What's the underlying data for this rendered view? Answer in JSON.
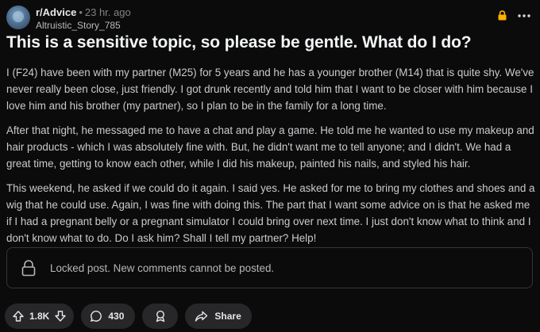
{
  "post": {
    "subreddit": "r/Advice",
    "time_ago": "23 hr. ago",
    "separator": "•",
    "author": "Altruistic_Story_785",
    "title": "This is a sensitive topic, so please be gentle. What do I do?",
    "paragraphs": [
      "I (F24) have been with my partner (M25) for 5 years and he has a younger brother (M14) that is quite shy. We've never really been close, just friendly. I got drunk recently and told him that I want to be closer with him because I love him and his brother (my partner), so I plan to be in the family for a long time.",
      "After that night, he messaged me to have a chat and play a game. He told me he wanted to use my makeup and hair products - which I was absolutely fine with. But, he didn't want me to tell anyone; and I didn't. We had a great time, getting to know each other, while I did his makeup, painted his nails, and styled his hair.",
      "This weekend, he asked if we could do it again. I said yes. He asked for me to bring my clothes and shoes and a wig that he could use. Again, I was fine with doing this. The part that I want some advice on is that he asked me if I had a pregnant belly or a pregnant simulator I could bring over next time. I just don't know what to think and I don't know what to do. Do I ask him? Shall I tell my partner? Help!"
    ],
    "locked_notice": "Locked post. New comments cannot be posted.",
    "votes": "1.8K",
    "comments": "430",
    "share_label": "Share"
  },
  "colors": {
    "background": "#0b0b0c",
    "lock_accent": "#ffb000",
    "pill_background": "#272729",
    "border": "#343536"
  },
  "icons": [
    "lock-icon",
    "more-options-icon",
    "upvote-icon",
    "downvote-icon",
    "comment-icon",
    "award-icon",
    "share-icon"
  ]
}
